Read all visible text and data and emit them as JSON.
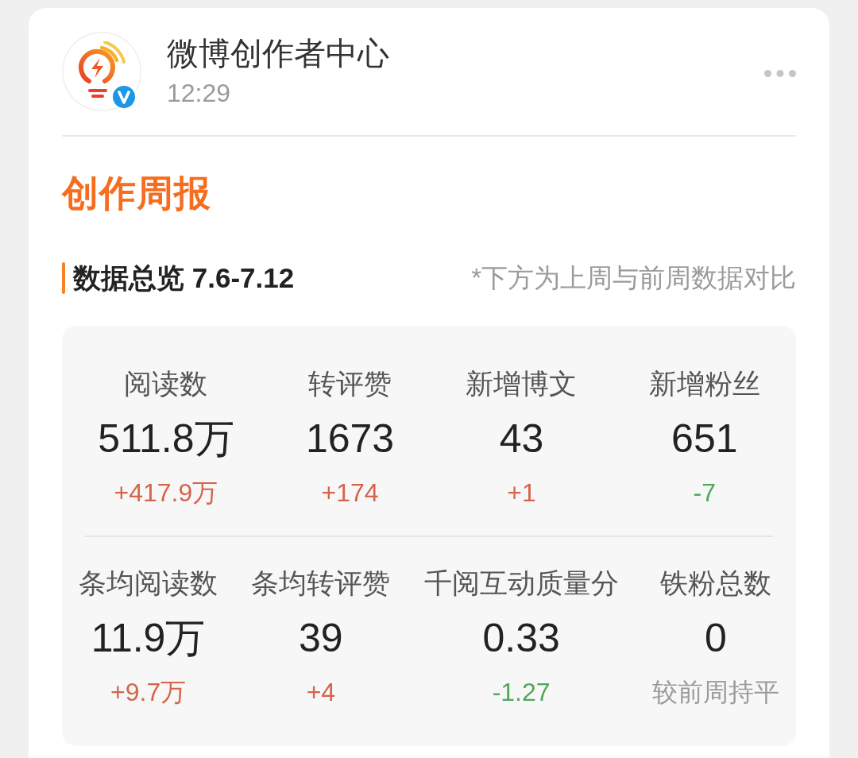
{
  "post": {
    "author": "微博创作者中心",
    "time": "12:29",
    "verified": true
  },
  "report": {
    "title": "创作周报",
    "section": {
      "title": "数据总览 7.6-7.12",
      "note": "*下方为上周与前周数据对比"
    },
    "stat_rows": [
      {
        "cells": [
          {
            "label": "阅读数",
            "value": "511.8万",
            "change": "+417.9万",
            "color": "#d6644b"
          },
          {
            "label": "转评赞",
            "value": "1673",
            "change": "+174",
            "color": "#d6644b"
          },
          {
            "label": "新增博文",
            "value": "43",
            "change": "+1",
            "color": "#d6644b"
          },
          {
            "label": "新增粉丝",
            "value": "651",
            "change": "-7",
            "color": "#4fa95a"
          }
        ]
      },
      {
        "cells": [
          {
            "label": "条均阅读数",
            "value": "11.9万",
            "change": "+9.7万",
            "color": "#d6644b"
          },
          {
            "label": "条均转评赞",
            "value": "39",
            "change": "+4",
            "color": "#d6644b"
          },
          {
            "label": "千阅互动质量分",
            "value": "0.33",
            "change": "-1.27",
            "color": "#4fa95a"
          },
          {
            "label": "铁粉总数",
            "value": "0",
            "change": "较前周持平",
            "color": "#9b9b9b"
          }
        ]
      }
    ]
  }
}
